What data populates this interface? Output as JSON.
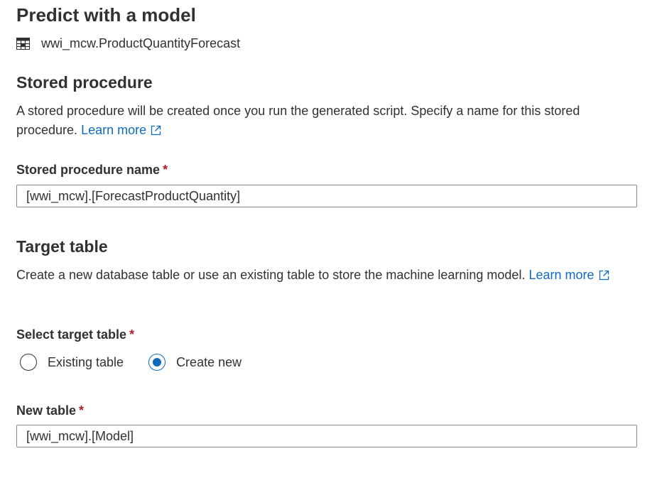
{
  "title": "Predict with a model",
  "model": {
    "icon": "table-icon",
    "name": "wwi_mcw.ProductQuantityForecast"
  },
  "stored_procedure": {
    "heading": "Stored procedure",
    "description": "A stored procedure will be created once you run the generated script. Specify a name for this stored procedure.",
    "learn_more": "Learn more",
    "name_label": "Stored procedure name",
    "required_marker": "*",
    "name_value": "[wwi_mcw].[ForecastProductQuantity]"
  },
  "target_table": {
    "heading": "Target table",
    "description": "Create a new database table or use an existing table to store the machine learning model.",
    "learn_more": "Learn more",
    "select_label": "Select target table",
    "required_marker": "*",
    "options": [
      {
        "label": "Existing table",
        "checked": false
      },
      {
        "label": "Create new",
        "checked": true
      }
    ],
    "new_table_label": "New table",
    "new_table_value": "[wwi_mcw].[Model]"
  },
  "colors": {
    "accent": "#0f6cbd",
    "required": "#a4262c",
    "text": "#323130",
    "border": "#8a8886"
  }
}
